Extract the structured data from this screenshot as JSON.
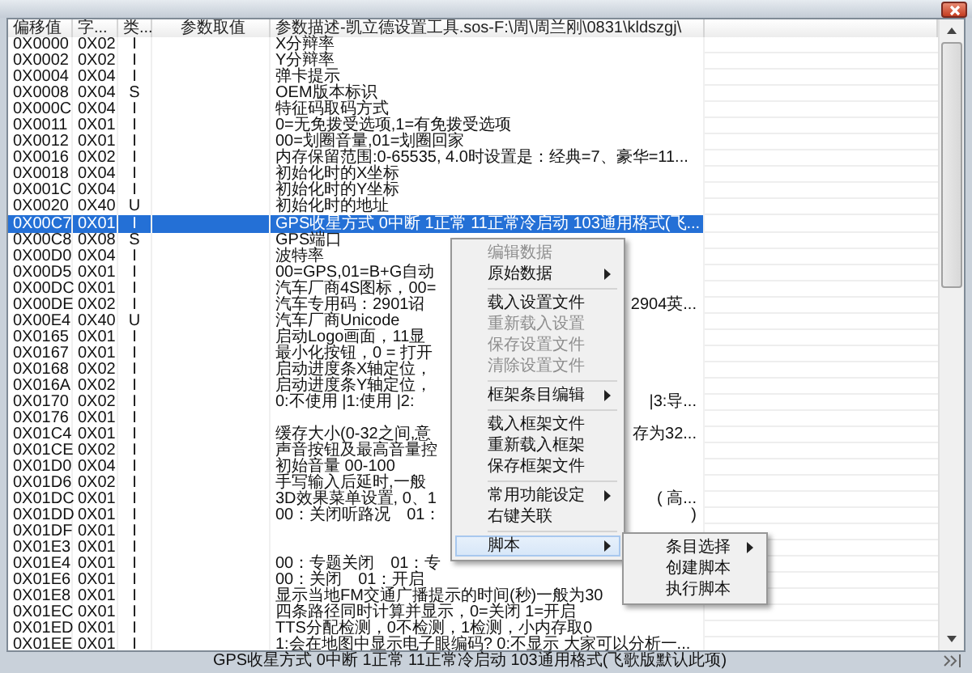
{
  "table": {
    "columns": [
      "偏移值",
      "字...",
      "类...",
      "参数取值",
      "参数描述-凯立德设置工具.sos-F:\\周\\周兰刚\\0831\\kldszgj\\"
    ],
    "rows": [
      {
        "offset": "0X0000",
        "size": "0X02",
        "type": "I",
        "desc": "X分辩率",
        "selected": false
      },
      {
        "offset": "0X0002",
        "size": "0X02",
        "type": "I",
        "desc": "Y分辩率",
        "selected": false
      },
      {
        "offset": "0X0004",
        "size": "0X04",
        "type": "I",
        "desc": "弹卡提示",
        "selected": false
      },
      {
        "offset": "0X0008",
        "size": "0X04",
        "type": "S",
        "desc": "OEM版本标识",
        "selected": false
      },
      {
        "offset": "0X000C",
        "size": "0X04",
        "type": "I",
        "desc": "特征码取码方式",
        "selected": false
      },
      {
        "offset": "0X0011",
        "size": "0X01",
        "type": "I",
        "desc": "0=无免拨受选项,1=有免拨受选项",
        "selected": false
      },
      {
        "offset": "0X0012",
        "size": "0X01",
        "type": "I",
        "desc": "00=划圈音量,01=划圈回家",
        "selected": false
      },
      {
        "offset": "0X0016",
        "size": "0X02",
        "type": "I",
        "desc": "内存保留范围:0-65535, 4.0时设置是：经典=7、豪华=11...",
        "selected": false
      },
      {
        "offset": "0X0018",
        "size": "0X04",
        "type": "I",
        "desc": "初始化时的X坐标",
        "selected": false
      },
      {
        "offset": "0X001C",
        "size": "0X04",
        "type": "I",
        "desc": "初始化时的Y坐标",
        "selected": false
      },
      {
        "offset": "0X0020",
        "size": "0X40",
        "type": "U",
        "desc": "初始化时的地址",
        "selected": false
      },
      {
        "offset": "0X00C7",
        "size": "0X01",
        "type": "I",
        "desc": "GPS收星方式 0中断 1正常 11正常冷启动 103通用格式(飞...",
        "selected": true
      },
      {
        "offset": "0X00C8",
        "size": "0X08",
        "type": "S",
        "desc": "GPS端口",
        "selected": false
      },
      {
        "offset": "0X00D0",
        "size": "0X04",
        "type": "I",
        "desc": "波特率",
        "selected": false
      },
      {
        "offset": "0X00D5",
        "size": "0X01",
        "type": "I",
        "desc": "00=GPS,01=B+G自动",
        "selected": false
      },
      {
        "offset": "0X00DC",
        "size": "0X01",
        "type": "I",
        "desc": "汽车厂商4S图标，00=",
        "selected": false
      },
      {
        "offset": "0X00DE",
        "size": "0X02",
        "type": "I",
        "desc": "汽车专用码：2901诏",
        "desc_tail": "2904英...",
        "selected": false
      },
      {
        "offset": "0X00E4",
        "size": "0X40",
        "type": "U",
        "desc": "汽车厂商Unicode",
        "selected": false
      },
      {
        "offset": "0X0165",
        "size": "0X01",
        "type": "I",
        "desc": "启动Logo画面，11显",
        "selected": false
      },
      {
        "offset": "0X0167",
        "size": "0X01",
        "type": "I",
        "desc": "最小化按钮，0 = 打开",
        "selected": false
      },
      {
        "offset": "0X0168",
        "size": "0X02",
        "type": "I",
        "desc": "启动进度条X轴定位，",
        "selected": false
      },
      {
        "offset": "0X016A",
        "size": "0X02",
        "type": "I",
        "desc": "启动进度条Y轴定位，",
        "selected": false
      },
      {
        "offset": "0X0170",
        "size": "0X02",
        "type": "I",
        "desc": "0:不使用 |1:使用 |2:",
        "desc_tail": "|3:导...",
        "selected": false
      },
      {
        "offset": "0X0176",
        "size": "0X01",
        "type": "I",
        "selected": false
      },
      {
        "offset": "0X01C4",
        "size": "0X01",
        "type": "I",
        "desc": "缓存大小(0-32之间,意",
        "desc_tail": "存为32...",
        "selected": false
      },
      {
        "offset": "0X01CE",
        "size": "0X02",
        "type": "I",
        "desc": "声音按钮及最高音量控",
        "selected": false
      },
      {
        "offset": "0X01D0",
        "size": "0X04",
        "type": "I",
        "desc": "初始音量 00-100",
        "selected": false
      },
      {
        "offset": "0X01D6",
        "size": "0X02",
        "type": "I",
        "desc": "手写输入后延时,一般",
        "selected": false
      },
      {
        "offset": "0X01DC",
        "size": "0X01",
        "type": "I",
        "desc": "3D效果菜单设置, 0、1",
        "desc_tail": "( 高...",
        "selected": false
      },
      {
        "offset": "0X01DD",
        "size": "0X01",
        "type": "I",
        "desc": "00：关闭听路况　01：",
        "desc_tail": ")",
        "selected": false
      },
      {
        "offset": "0X01DF",
        "size": "0X01",
        "type": "I",
        "selected": false
      },
      {
        "offset": "0X01E3",
        "size": "0X01",
        "type": "I",
        "selected": false
      },
      {
        "offset": "0X01E4",
        "size": "0X01",
        "type": "I",
        "desc": "00：专题关闭　01：专",
        "selected": false
      },
      {
        "offset": "0X01E6",
        "size": "0X01",
        "type": "I",
        "desc": "00：关闭　01：开启",
        "selected": false
      },
      {
        "offset": "0X01E8",
        "size": "0X01",
        "type": "I",
        "desc": "显示当地FM交通广播提示的时间(秒)一般为30",
        "selected": false
      },
      {
        "offset": "0X01EC",
        "size": "0X01",
        "type": "I",
        "desc": "四条路径同时计算并显示，0=关闭 1=开启",
        "selected": false
      },
      {
        "offset": "0X01ED",
        "size": "0X01",
        "type": "I",
        "desc": "TTS分配检测，0不检测，1检测，小内存取0",
        "selected": false
      },
      {
        "offset": "0X01EE",
        "size": "0X01",
        "type": "I",
        "desc": "1:会在地图中显示电子眼编码? 0:不显示 大家可以分析一...",
        "selected": false
      }
    ]
  },
  "context_menu": {
    "items": [
      {
        "kind": "item",
        "label": "编辑数据",
        "disabled": true,
        "submenu": false,
        "selected": false
      },
      {
        "kind": "item",
        "label": "原始数据",
        "disabled": false,
        "submenu": true,
        "selected": false
      },
      {
        "kind": "separator"
      },
      {
        "kind": "item",
        "label": "载入设置文件",
        "disabled": false,
        "submenu": false,
        "selected": false
      },
      {
        "kind": "item",
        "label": "重新载入设置",
        "disabled": true,
        "submenu": false,
        "selected": false
      },
      {
        "kind": "item",
        "label": "保存设置文件",
        "disabled": true,
        "submenu": false,
        "selected": false
      },
      {
        "kind": "item",
        "label": "清除设置文件",
        "disabled": true,
        "submenu": false,
        "selected": false
      },
      {
        "kind": "separator"
      },
      {
        "kind": "item",
        "label": "框架条目编辑",
        "disabled": false,
        "submenu": true,
        "selected": false
      },
      {
        "kind": "separator"
      },
      {
        "kind": "item",
        "label": "载入框架文件",
        "disabled": false,
        "submenu": false,
        "selected": false
      },
      {
        "kind": "item",
        "label": "重新载入框架",
        "disabled": false,
        "submenu": false,
        "selected": false
      },
      {
        "kind": "item",
        "label": "保存框架文件",
        "disabled": false,
        "submenu": false,
        "selected": false
      },
      {
        "kind": "separator"
      },
      {
        "kind": "item",
        "label": "常用功能设定",
        "disabled": false,
        "submenu": true,
        "selected": false
      },
      {
        "kind": "item",
        "label": "右键关联",
        "disabled": false,
        "submenu": false,
        "selected": false
      },
      {
        "kind": "separator"
      },
      {
        "kind": "item",
        "label": "脚本",
        "disabled": false,
        "submenu": true,
        "selected": true
      }
    ]
  },
  "submenu": {
    "items": [
      {
        "kind": "item",
        "label": "条目选择",
        "disabled": false,
        "submenu": true,
        "selected": false
      },
      {
        "kind": "item",
        "label": "创建脚本",
        "disabled": false,
        "submenu": false,
        "selected": false
      },
      {
        "kind": "item",
        "label": "执行脚本",
        "disabled": false,
        "submenu": false,
        "selected": false
      }
    ]
  },
  "status_bar": {
    "text": "GPS收星方式 0中断 1正常 11正常冷启动 103通用格式(飞歌版默认此项)"
  }
}
